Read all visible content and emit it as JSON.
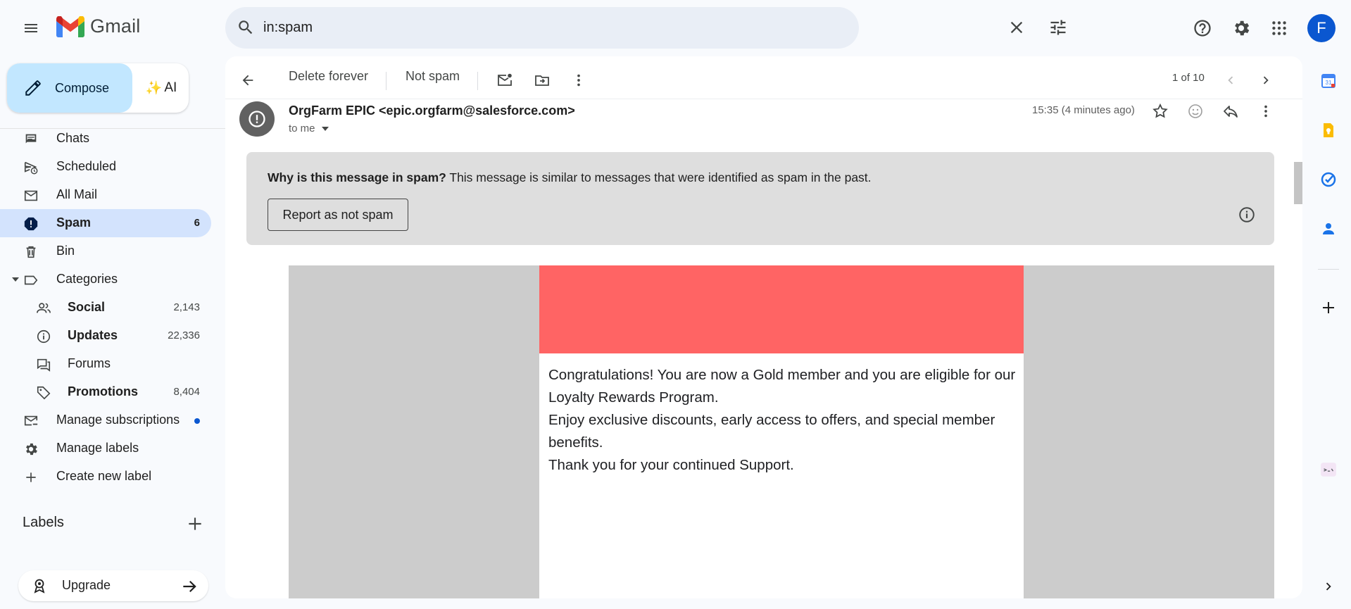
{
  "header": {
    "app_name": "Gmail",
    "search_value": "in:spam",
    "avatar_letter": "F"
  },
  "compose": {
    "label": "Compose",
    "ai_label": "AI"
  },
  "sidebar": {
    "items": [
      {
        "label": "Chats",
        "count": ""
      },
      {
        "label": "Scheduled",
        "count": ""
      },
      {
        "label": "All Mail",
        "count": ""
      },
      {
        "label": "Spam",
        "count": "6"
      },
      {
        "label": "Bin",
        "count": ""
      },
      {
        "label": "Categories",
        "count": ""
      },
      {
        "label": "Social",
        "count": "2,143"
      },
      {
        "label": "Updates",
        "count": "22,336"
      },
      {
        "label": "Forums",
        "count": ""
      },
      {
        "label": "Promotions",
        "count": "8,404"
      },
      {
        "label": "Manage subscriptions",
        "count": ""
      },
      {
        "label": "Manage labels",
        "count": ""
      },
      {
        "label": "Create new label",
        "count": ""
      }
    ],
    "labels_header": "Labels",
    "upgrade": "Upgrade"
  },
  "toolbar": {
    "delete_forever": "Delete forever",
    "not_spam": "Not spam",
    "count": "1 of 10"
  },
  "message": {
    "sender": "OrgFarm EPIC <epic.orgfarm@salesforce.com>",
    "to": "to me",
    "time": "15:35 (4 minutes ago)",
    "spam_why_bold": "Why is this message in spam?",
    "spam_why_text": " This message is similar to messages that were identified as spam in the past.",
    "report_button": "Report as not spam",
    "body_lines": [
      "Congratulations! You are now a Gold member and you are eligible for our Loyalty Rewards Program.",
      "Enjoy exclusive discounts, early access to offers, and special member benefits.",
      "Thank you for your continued Support."
    ]
  },
  "colors": {
    "accent": "#0b57d0",
    "active_nav": "#d3e3fd",
    "compose_bg": "#c2e7ff",
    "banner": "#ff6464"
  }
}
